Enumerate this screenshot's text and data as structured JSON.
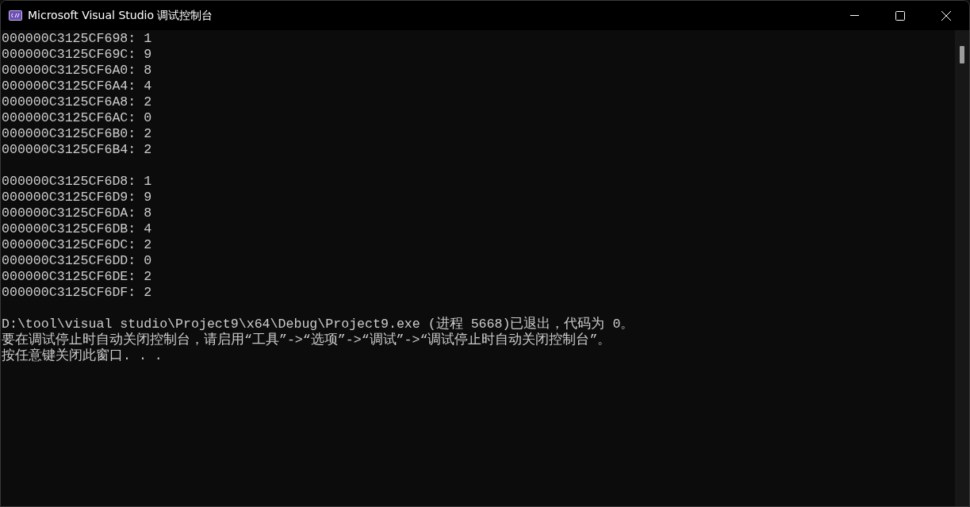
{
  "window": {
    "title": "Microsoft Visual Studio 调试控制台"
  },
  "console": {
    "blocks": [
      [
        "000000C3125CF698: 1",
        "000000C3125CF69C: 9",
        "000000C3125CF6A0: 8",
        "000000C3125CF6A4: 4",
        "000000C3125CF6A8: 2",
        "000000C3125CF6AC: 0",
        "000000C3125CF6B0: 2",
        "000000C3125CF6B4: 2"
      ],
      [
        "000000C3125CF6D8: 1",
        "000000C3125CF6D9: 9",
        "000000C3125CF6DA: 8",
        "000000C3125CF6DB: 4",
        "000000C3125CF6DC: 2",
        "000000C3125CF6DD: 0",
        "000000C3125CF6DE: 2",
        "000000C3125CF6DF: 2"
      ],
      [
        "D:\\tool\\visual studio\\Project9\\x64\\Debug\\Project9.exe (进程 5668)已退出，代码为 0。",
        "要在调试停止时自动关闭控制台，请启用“工具”->“选项”->“调试”->“调试停止时自动关闭控制台”。",
        "按任意键关闭此窗口. . ."
      ]
    ]
  }
}
